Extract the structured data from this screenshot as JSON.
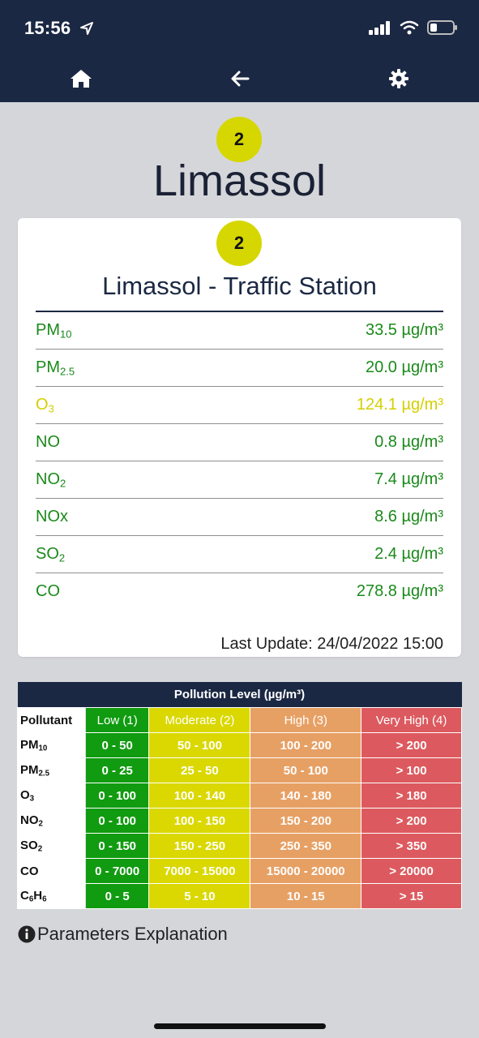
{
  "status_bar": {
    "time": "15:56"
  },
  "nav": {
    "home_icon": "home-icon",
    "back_icon": "arrow-left-icon",
    "settings_icon": "gear-icon"
  },
  "city": {
    "aqi": "2",
    "name": "Limassol"
  },
  "station": {
    "aqi": "2",
    "name": "Limassol - Traffic Station",
    "readings": [
      {
        "pollutant": "PM",
        "sub": "10",
        "value": "33.5 µg/m³",
        "color": "#1a8a1a"
      },
      {
        "pollutant": "PM",
        "sub": "2.5",
        "value": "20.0 µg/m³",
        "color": "#1a8a1a"
      },
      {
        "pollutant": "O",
        "sub": "3",
        "value": "124.1 µg/m³",
        "color": "#d4cf00"
      },
      {
        "pollutant": "NO",
        "sub": "",
        "value": "0.8 µg/m³",
        "color": "#1a8a1a"
      },
      {
        "pollutant": "NO",
        "sub": "2",
        "value": "7.4 µg/m³",
        "color": "#1a8a1a"
      },
      {
        "pollutant": "NOx",
        "sub": "",
        "value": "8.6 µg/m³",
        "color": "#1a8a1a"
      },
      {
        "pollutant": "SO",
        "sub": "2",
        "value": "2.4 µg/m³",
        "color": "#1a8a1a"
      },
      {
        "pollutant": "CO",
        "sub": "",
        "value": "278.8 µg/m³",
        "color": "#1a8a1a"
      }
    ],
    "last_update": "Last Update: 24/04/2022 15:00"
  },
  "levels_table": {
    "title": "Pollution Level (µg/m³)",
    "headers": [
      "Pollutant",
      "Low (1)",
      "Moderate (2)",
      "High (3)",
      "Very High (4)"
    ],
    "rows": [
      {
        "pollutant": "PM",
        "sub": "10",
        "cells": [
          "0 - 50",
          "50 - 100",
          "100 - 200",
          "> 200"
        ]
      },
      {
        "pollutant": "PM",
        "sub": "2.5",
        "cells": [
          "0 - 25",
          "25 - 50",
          "50 - 100",
          "> 100"
        ]
      },
      {
        "pollutant": "O",
        "sub": "3",
        "cells": [
          "0 - 100",
          "100 - 140",
          "140 - 180",
          "> 180"
        ]
      },
      {
        "pollutant": "NO",
        "sub": "2",
        "cells": [
          "0 - 100",
          "100 - 150",
          "150 - 200",
          "> 200"
        ]
      },
      {
        "pollutant": "SO",
        "sub": "2",
        "cells": [
          "0 - 150",
          "150 - 250",
          "250 - 350",
          "> 350"
        ]
      },
      {
        "pollutant": "CO",
        "sub": "",
        "cells": [
          "0 - 7000",
          "7000 - 15000",
          "15000 - 20000",
          "> 20000"
        ]
      },
      {
        "pollutant": "C",
        "sub": "6",
        "pollutant2": "H",
        "sub2": "6",
        "cells": [
          "0 - 5",
          "5 - 10",
          "10 - 15",
          "> 15"
        ]
      }
    ],
    "colors": {
      "low": "#119b11",
      "moderate": "#dad800",
      "high": "#e7a064",
      "very_high": "#dc5a5f"
    }
  },
  "explanation_link": "Parameters Explanation"
}
